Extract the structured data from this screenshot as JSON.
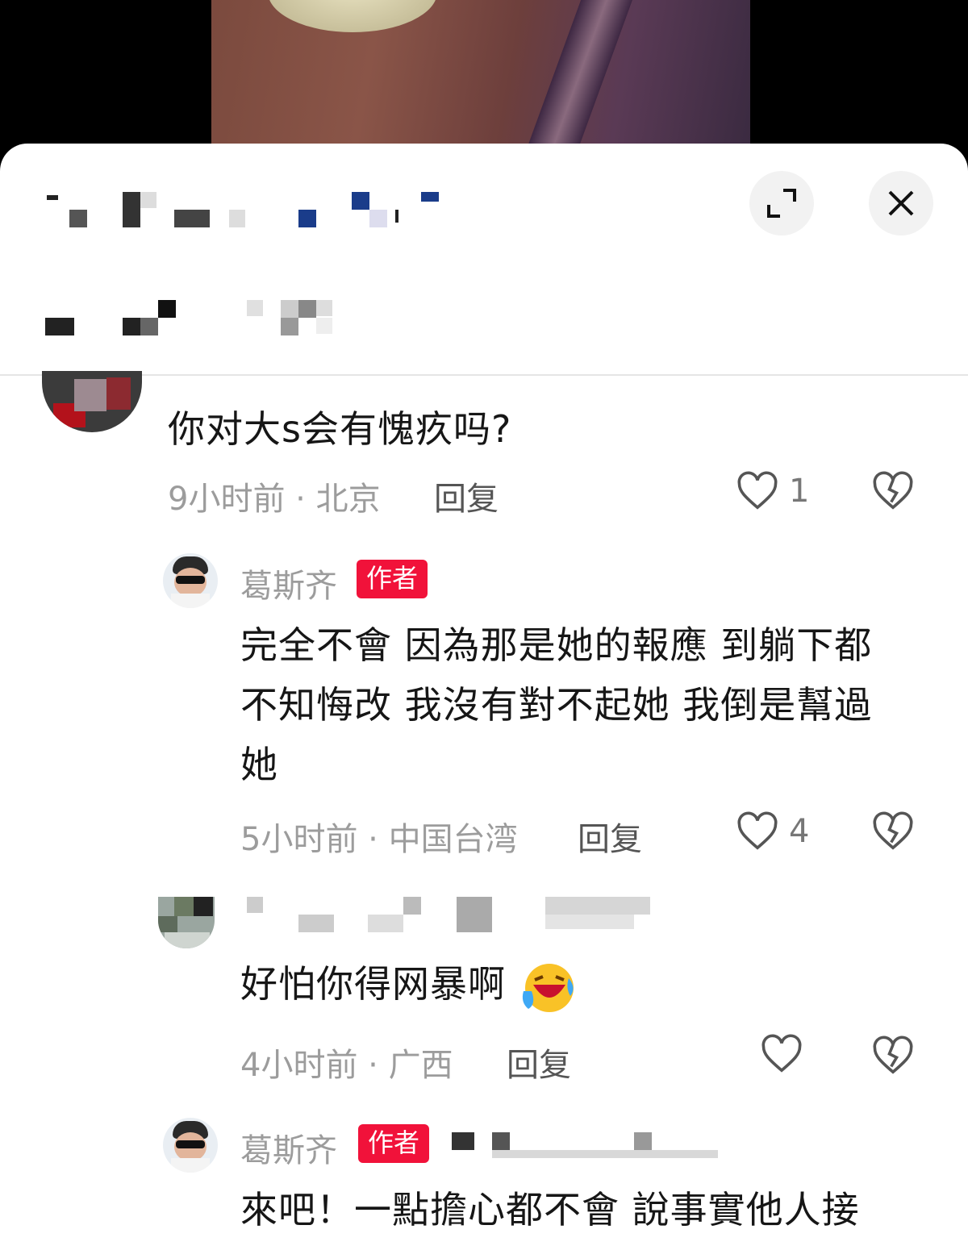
{
  "comments": [
    {
      "text": "你对大s会有愧疚吗?",
      "meta": "9小时前 · 北京",
      "reply": "回复",
      "likes": "1"
    },
    {
      "author": "葛斯齐",
      "badge": "作者",
      "text_lines": [
        "完全不會 因為那是她的報應 到躺下都",
        "不知悔改 我沒有對不起她 我倒是幫過",
        "她"
      ],
      "meta": "5小时前 · 中国台湾",
      "reply": "回复",
      "likes": "4"
    },
    {
      "text": "好怕你得网暴啊",
      "meta": "4小时前 · 广西",
      "reply": "回复"
    },
    {
      "author": "葛斯齐",
      "badge": "作者",
      "text": "來吧！一點擔心都不會 說事實他人接"
    }
  ],
  "colors": {
    "badge": "#f1123a",
    "meta": "#9c9c9c",
    "text": "#161616"
  },
  "icons": [
    "expand-icon",
    "close-icon",
    "heart-icon",
    "dislike-icon",
    "laughing-emoji"
  ]
}
